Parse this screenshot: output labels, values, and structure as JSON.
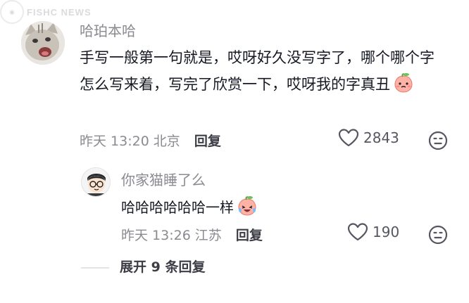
{
  "watermark": {
    "brand_text": "FISHC NEWS",
    "icon": "fishc-logo-icon"
  },
  "comment": {
    "avatar_icon": "cat-avatar-icon",
    "username": "哈珀本哈",
    "text": "手写一般第一句就是，哎呀好久没写字了，哪个哪个字怎么写来着，写完了欣赏一下，哎呀我的字真丑",
    "emoji": "peach-blush-emoji",
    "time": "昨天 13:20",
    "location": "北京",
    "reply_label": "回复",
    "like_icon": "heart-icon",
    "like_count": "2843",
    "dislike_icon": "frown-icon"
  },
  "reply": {
    "avatar_icon": "cartoon-boy-avatar-icon",
    "username": "你家猫睡了么",
    "text": "哈哈哈哈哈哈一样",
    "emoji": "peach-laugh-cry-emoji",
    "time": "昨天 13:26",
    "location": "江苏",
    "reply_label": "回复",
    "like_icon": "heart-icon",
    "like_count": "190",
    "dislike_icon": "frown-icon"
  },
  "expand": {
    "label": "展开 9 条回复"
  },
  "colors": {
    "primary_text": "#161823",
    "secondary_text": "#8a8b91",
    "action_text": "#3c3d45",
    "background": "#ffffff"
  }
}
